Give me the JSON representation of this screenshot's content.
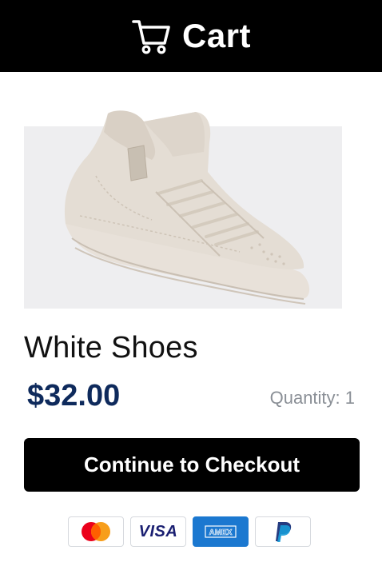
{
  "header": {
    "title": "Cart",
    "icon": "cart-icon"
  },
  "product": {
    "name": "White Shoes",
    "price": "$32.00",
    "quantity_label": "Quantity: 1",
    "image_icon": "shoe-image"
  },
  "checkout": {
    "label": "Continue to Checkout"
  },
  "payments": [
    {
      "name": "Mastercard",
      "icon": "mastercard-icon"
    },
    {
      "name": "Visa",
      "label": "VISA",
      "icon": "visa-icon"
    },
    {
      "name": "American Express",
      "label": "AMEX",
      "icon": "amex-icon"
    },
    {
      "name": "PayPal",
      "icon": "paypal-icon"
    }
  ],
  "colors": {
    "header_bg": "#000000",
    "price": "#0e2a5c",
    "quantity": "#8a8f96",
    "button_bg": "#000000",
    "amex_blue": "#1b78d0",
    "visa_blue": "#1a1f71"
  }
}
